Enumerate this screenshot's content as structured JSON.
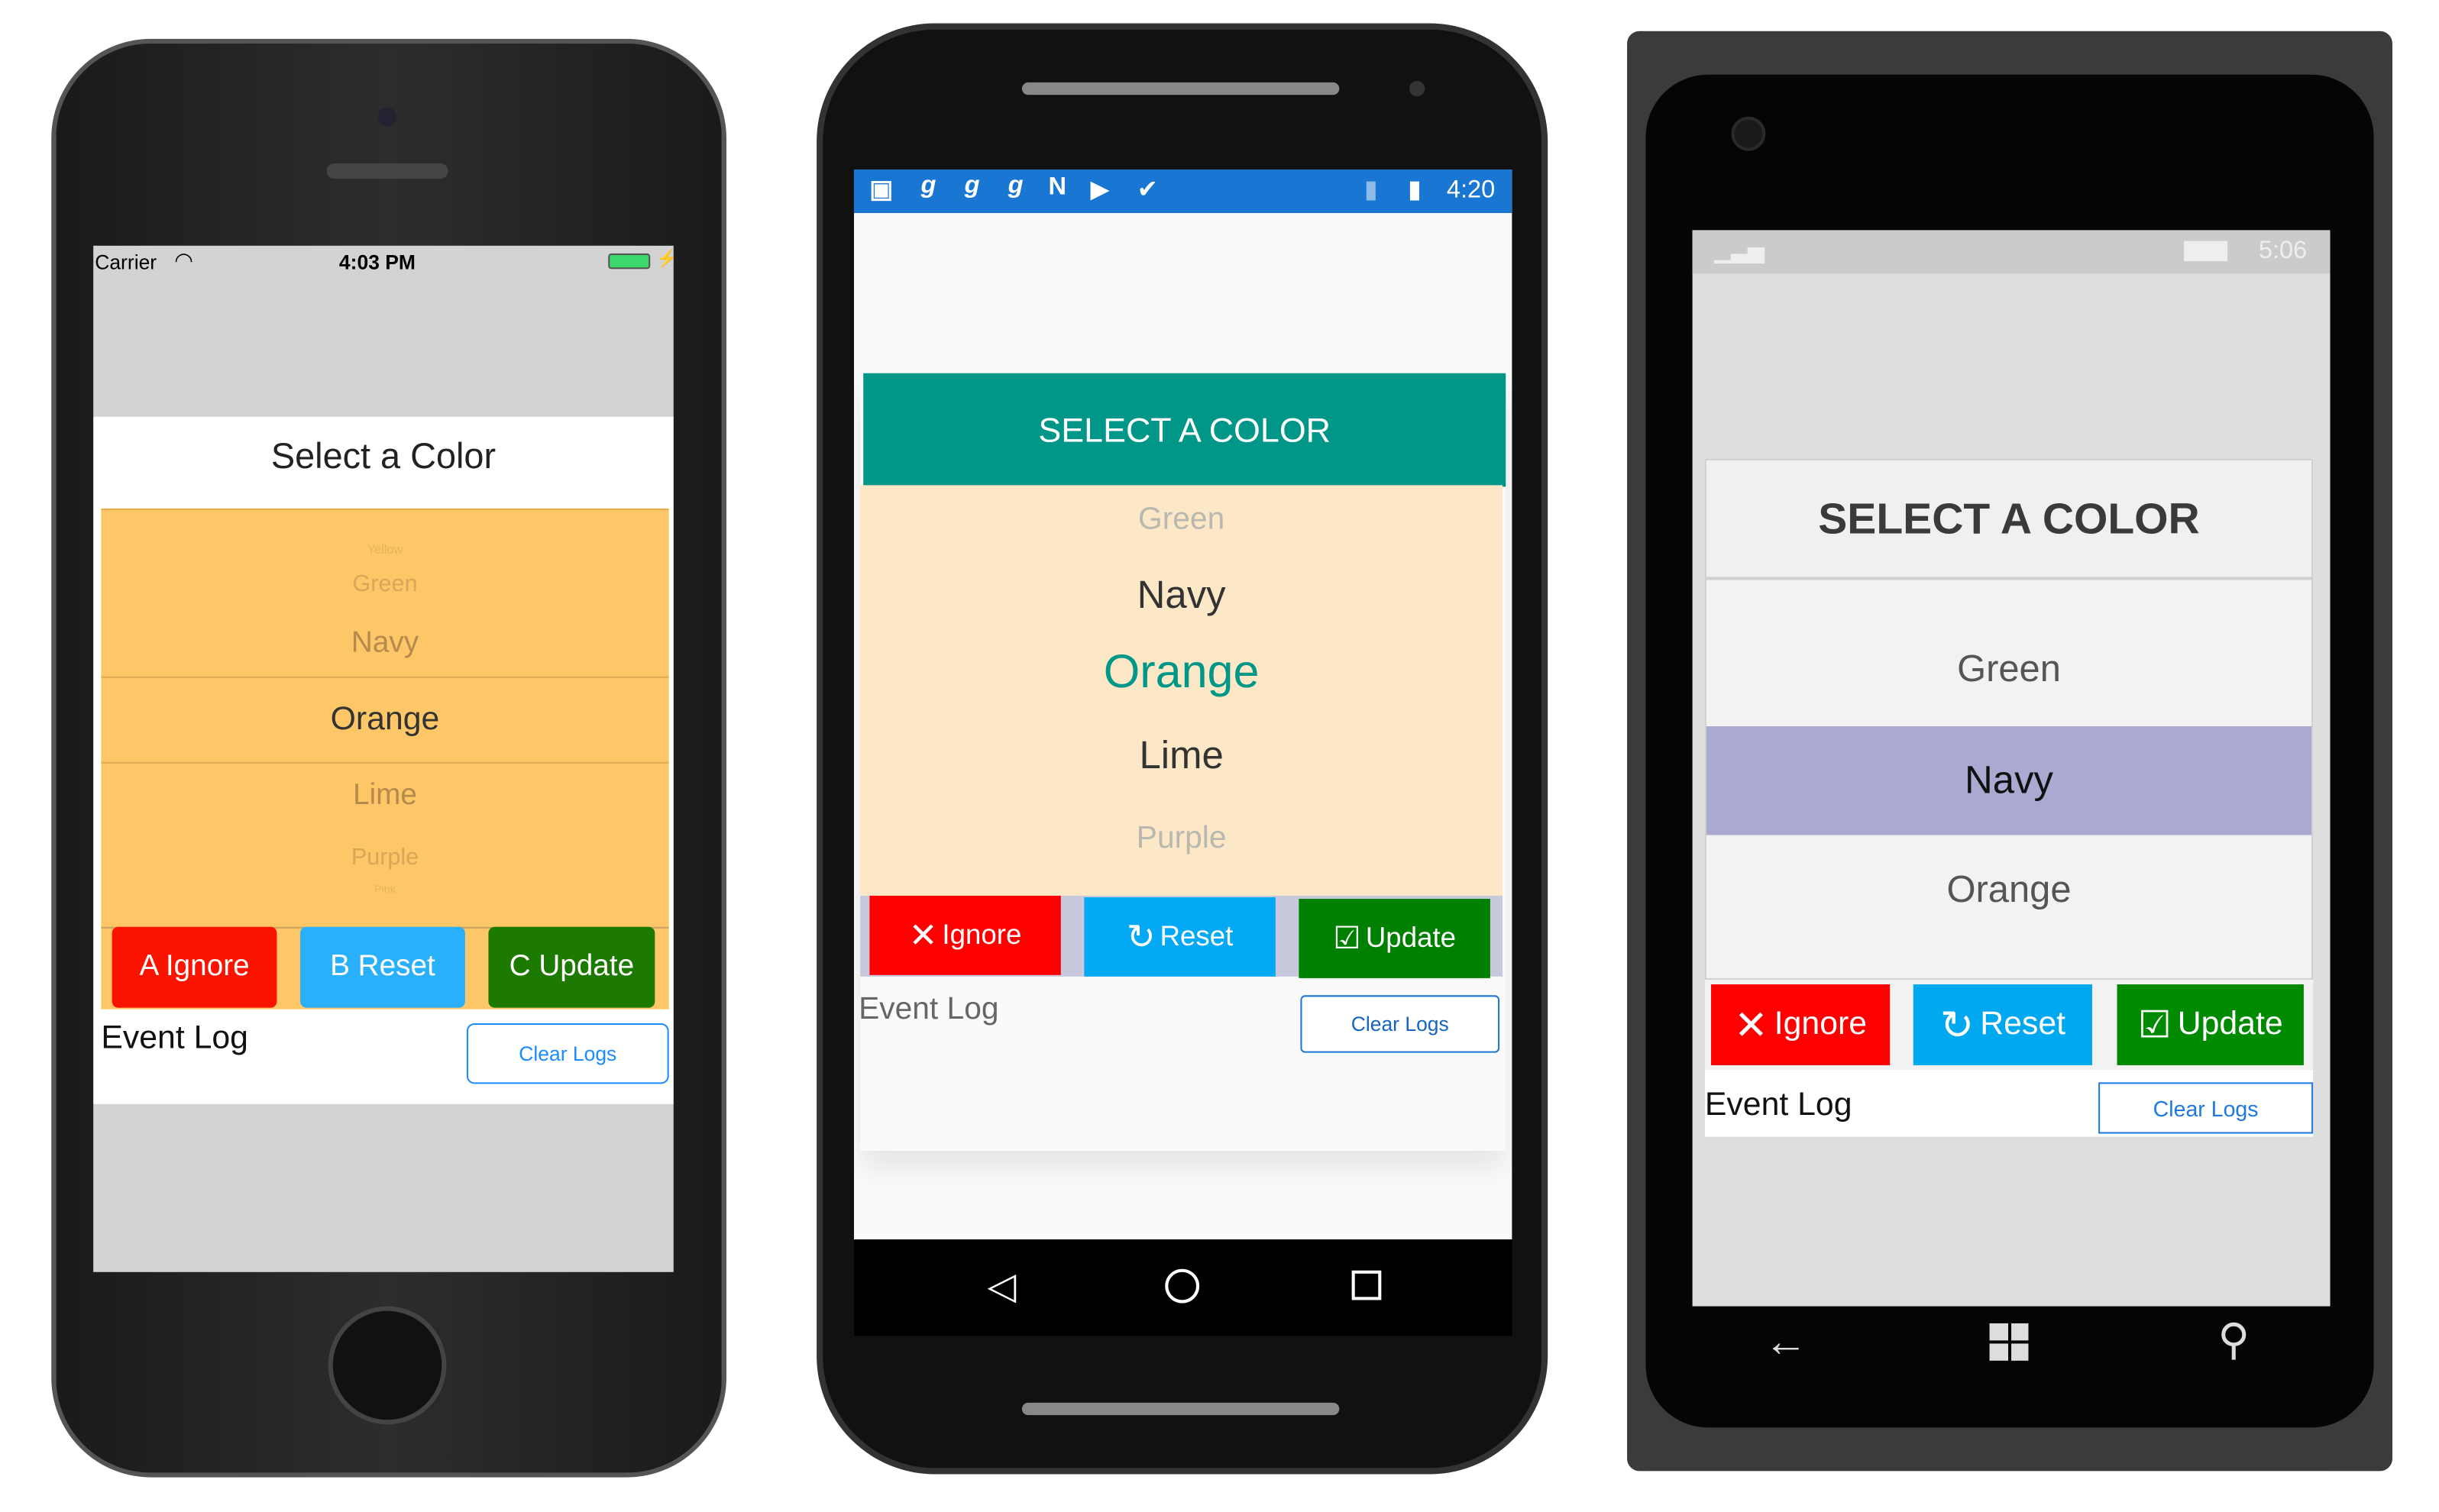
{
  "ios": {
    "status": {
      "carrier": "Carrier",
      "time": "4:03 PM"
    },
    "title": "Select a Color",
    "picker": [
      "Yellow",
      "Green",
      "Navy",
      "Orange",
      "Lime",
      "Purple",
      "Pink"
    ],
    "selected": "Orange",
    "buttons": [
      "A Ignore",
      "B Reset",
      "C Update"
    ],
    "event_log": "Event Log",
    "clear_logs": "Clear Logs",
    "colors": {
      "picker_bg": "#fdc767",
      "ignore": "#fa1400",
      "reset": "#2ab0fb",
      "update": "#1d7a00",
      "link": "#1a8cff"
    }
  },
  "android": {
    "status": {
      "time": "4:20",
      "icons": [
        "notification-icon",
        "g-icon",
        "g-icon",
        "g-icon",
        "n-icon",
        "youtube-icon",
        "play-store-icon",
        "no-sim-icon",
        "battery-charging-icon"
      ]
    },
    "title": "SELECT A COLOR",
    "picker": [
      "Green",
      "Navy",
      "Orange",
      "Lime",
      "Purple"
    ],
    "selected": "Orange",
    "buttons": [
      "Ignore",
      "Reset",
      "Update"
    ],
    "event_log": "Event Log",
    "clear_logs": "Clear Logs",
    "colors": {
      "status_bar": "#1976d2",
      "header": "#009688",
      "picker_bg": "#fce8c6",
      "ignore": "#ff0000",
      "reset": "#03a9f4",
      "update": "#008000"
    }
  },
  "windows": {
    "status": {
      "time": "5:06"
    },
    "title": "SELECT A COLOR",
    "picker": [
      "Green",
      "Navy",
      "Orange"
    ],
    "selected": "Navy",
    "buttons": [
      "Ignore",
      "Reset",
      "Update"
    ],
    "event_log": "Event Log",
    "clear_logs": "Clear Logs",
    "colors": {
      "highlight": "#a9a9d2",
      "ignore": "#ff0000",
      "reset": "#00a8f0",
      "update": "#008a00"
    }
  }
}
